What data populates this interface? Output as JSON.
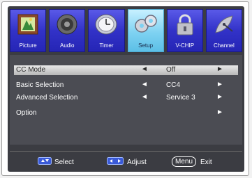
{
  "tabs": [
    {
      "label": "Picture",
      "icon": "picture-frame-icon",
      "active": false
    },
    {
      "label": "Audio",
      "icon": "speaker-icon",
      "active": false
    },
    {
      "label": "Timer",
      "icon": "clock-icon",
      "active": false
    },
    {
      "label": "Setup",
      "icon": "gears-icon",
      "active": true
    },
    {
      "label": "V-CHIP",
      "icon": "padlock-icon",
      "active": false
    },
    {
      "label": "Channel",
      "icon": "satellite-dish-icon",
      "active": false
    }
  ],
  "menu": {
    "rows": [
      {
        "label": "CC Mode",
        "value": "Off",
        "left_arrow": "◄",
        "right_arrow": "►",
        "selected": true
      },
      {
        "label": "Basic Selection",
        "value": "CC4",
        "left_arrow": "◄",
        "right_arrow": "►",
        "selected": false
      },
      {
        "label": "Advanced Selection",
        "value": "Service 3",
        "left_arrow": "◄",
        "right_arrow": "►",
        "selected": false
      },
      {
        "label": "Option",
        "value": "",
        "left_arrow": "",
        "right_arrow": "►",
        "selected": false
      }
    ]
  },
  "footer": {
    "select_label": "Select",
    "adjust_label": "Adjust",
    "menu_button": "Menu",
    "exit_label": "Exit"
  },
  "colors": {
    "tab_blue": "#3232c8",
    "tab_active": "#7ed2f2",
    "panel": "#4b4c53",
    "highlight": "#d0d0d0"
  }
}
